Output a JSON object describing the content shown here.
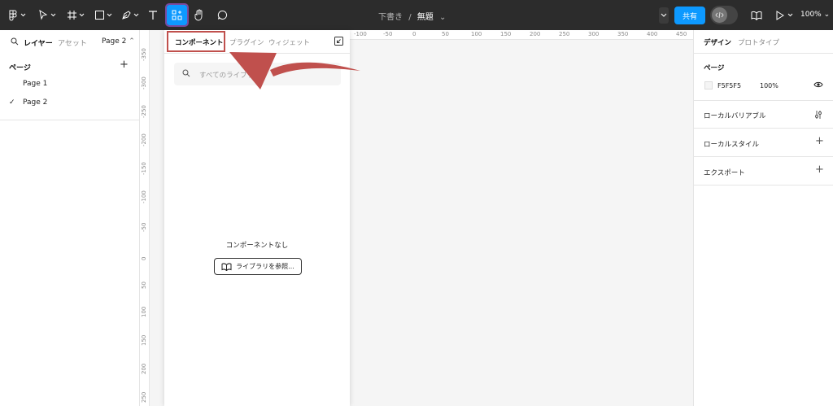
{
  "toolbar": {
    "tools": [
      {
        "name": "main-menu",
        "icon": "figma-menu-icon"
      },
      {
        "name": "move-tool",
        "icon": "cursor-arrow-icon"
      },
      {
        "name": "frame-tool",
        "icon": "frame-hash-icon"
      },
      {
        "name": "shape-tool",
        "icon": "rectangle-icon"
      },
      {
        "name": "pen-tool",
        "icon": "pen-icon"
      },
      {
        "name": "text-tool",
        "icon": "text-icon"
      },
      {
        "name": "resources-tool",
        "icon": "components-icon",
        "active": true
      },
      {
        "name": "hand-tool",
        "icon": "hand-icon"
      },
      {
        "name": "comment-tool",
        "icon": "comment-icon"
      }
    ],
    "breadcrumb": {
      "folder": "下書き",
      "separator": "/",
      "file": "無題"
    },
    "share_label": "共有",
    "zoom_label": "100%",
    "accent": "#0d99ff"
  },
  "left_panel": {
    "tabs": [
      {
        "label": "レイヤー",
        "active": true
      },
      {
        "label": "アセット",
        "active": false
      }
    ],
    "page_selector": "Page 2",
    "pages_header": "ページ",
    "pages": [
      {
        "label": "Page 1",
        "selected": false
      },
      {
        "label": "Page 2",
        "selected": true
      }
    ]
  },
  "assets_panel": {
    "tabs": [
      {
        "label": "コンポーネント",
        "active": true
      },
      {
        "label": "プラグイン",
        "active": false
      },
      {
        "label": "ウィジェット",
        "active": false
      }
    ],
    "search_placeholder": "すべてのライブラリを検索",
    "empty_message": "コンポーネントなし",
    "browse_button": "ライブラリを参照...",
    "highlight_color": "#c0504d"
  },
  "rulers": {
    "top": [
      "-100",
      "-50",
      "0",
      "50",
      "100",
      "150",
      "200",
      "250",
      "300",
      "350",
      "400",
      "450"
    ],
    "left": [
      "-350",
      "-300",
      "-250",
      "-200",
      "-150",
      "-100",
      "-50",
      "0",
      "50",
      "100",
      "150",
      "200",
      "250"
    ]
  },
  "right_panel": {
    "tabs": [
      {
        "label": "デザイン",
        "active": true
      },
      {
        "label": "プロトタイプ",
        "active": false
      }
    ],
    "page_header": "ページ",
    "page_fill_hex": "F5F5F5",
    "page_fill_opacity": "100%",
    "sections": [
      {
        "label": "ローカルバリアブル",
        "icon": "sliders-icon"
      },
      {
        "label": "ローカルスタイル",
        "icon": "plus-icon"
      },
      {
        "label": "エクスポート",
        "icon": "plus-icon"
      }
    ]
  }
}
